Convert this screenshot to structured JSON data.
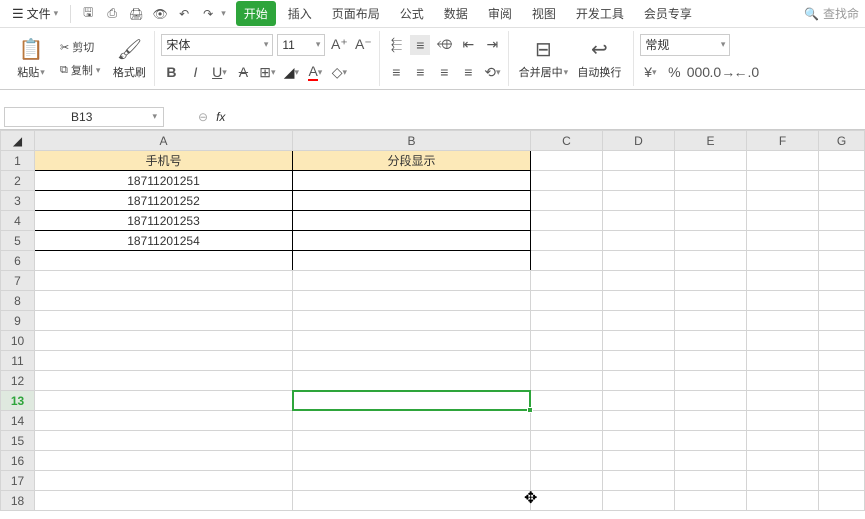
{
  "menu": {
    "file": "文件"
  },
  "tabs": {
    "start": "开始",
    "insert": "插入",
    "layout": "页面布局",
    "formula": "公式",
    "data": "数据",
    "review": "审阅",
    "view": "视图",
    "dev": "开发工具",
    "member": "会员专享"
  },
  "search": {
    "placeholder": "查找命"
  },
  "clipboard": {
    "paste": "粘贴",
    "cut": "剪切",
    "copy": "复制",
    "format": "格式刷"
  },
  "font": {
    "name": "宋体",
    "size": "11"
  },
  "align": {
    "merge": "合并居中",
    "wrap": "自动换行"
  },
  "number": {
    "format": "常规"
  },
  "namebox": {
    "value": "B13"
  },
  "cols": {
    "A": "A",
    "B": "B",
    "C": "C",
    "D": "D",
    "E": "E",
    "F": "F",
    "G": "G"
  },
  "headers": {
    "phone": "手机号",
    "segment": "分段显示"
  },
  "data": {
    "r2": "18711201251",
    "r3": "18711201252",
    "r4": "18711201253",
    "r5": "18711201254"
  },
  "icons": {
    "search": "🔍"
  }
}
